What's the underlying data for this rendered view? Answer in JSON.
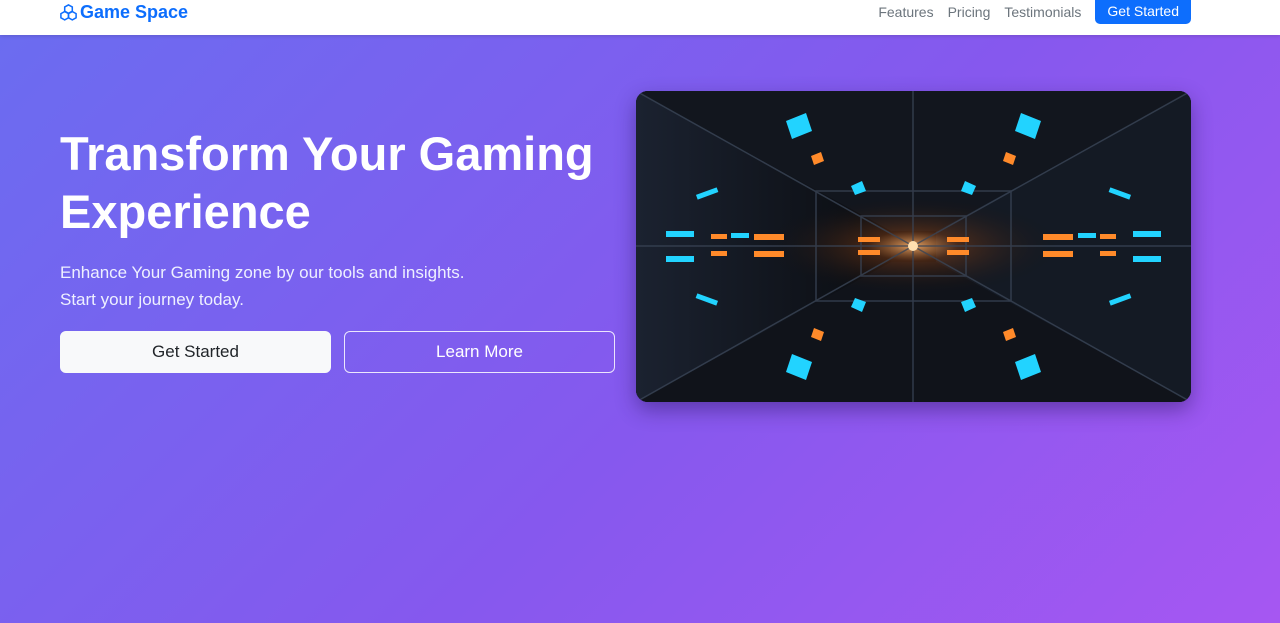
{
  "navbar": {
    "brand": "Game Space",
    "brand_icon": "boxes-icon",
    "links": [
      "Features",
      "Pricing",
      "Testimonials"
    ],
    "cta_label": "Get Started",
    "brand_color": "#0d6efd"
  },
  "hero": {
    "title": "Transform Your Gaming Experience",
    "subtitle_line1": "Enhance Your Gaming zone by our tools and insights.",
    "subtitle_line2": "Start your journey today.",
    "primary_button": "Get Started",
    "secondary_button": "Learn More",
    "image_description": "sci-fi neon corridor",
    "gradient_start": "#6b6cf0",
    "gradient_end": "#a657f2"
  }
}
